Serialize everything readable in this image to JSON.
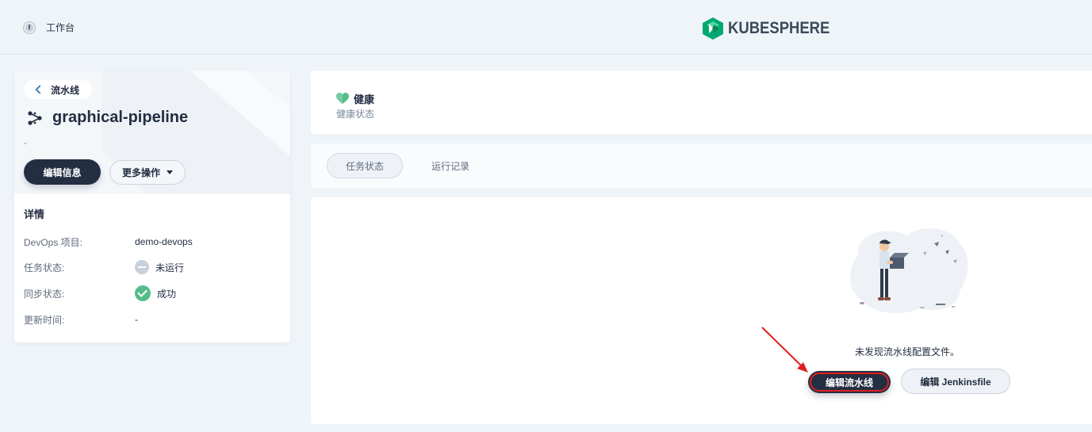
{
  "topbar": {
    "workbench_label": "工作台",
    "brand_name": "KUBESPHERE",
    "brand_color": "#00a971"
  },
  "pipeline": {
    "back_label": "流水线",
    "title": "graphical-pipeline",
    "description": "-",
    "edit_info_label": "编辑信息",
    "more_actions_label": "更多操作"
  },
  "details": {
    "heading": "详情",
    "rows": [
      {
        "label": "DevOps 项目:",
        "value": "demo-devops"
      },
      {
        "label": "任务状态:",
        "value": "未运行",
        "status": "gray"
      },
      {
        "label": "同步状态:",
        "value": "成功",
        "status": "green"
      },
      {
        "label": "更新时间:",
        "value": "-"
      }
    ]
  },
  "health": {
    "status": "健康",
    "label": "健康状态",
    "color": "#55bc8a"
  },
  "tabs": [
    {
      "label": "任务状态",
      "active": true
    },
    {
      "label": "运行记录",
      "active": false
    }
  ],
  "empty": {
    "message": "未发现流水线配置文件。",
    "edit_pipeline_label": "编辑流水线",
    "edit_jenkinsfile_label": "编辑 Jenkinsfile"
  },
  "annotation_color": "#e02020"
}
